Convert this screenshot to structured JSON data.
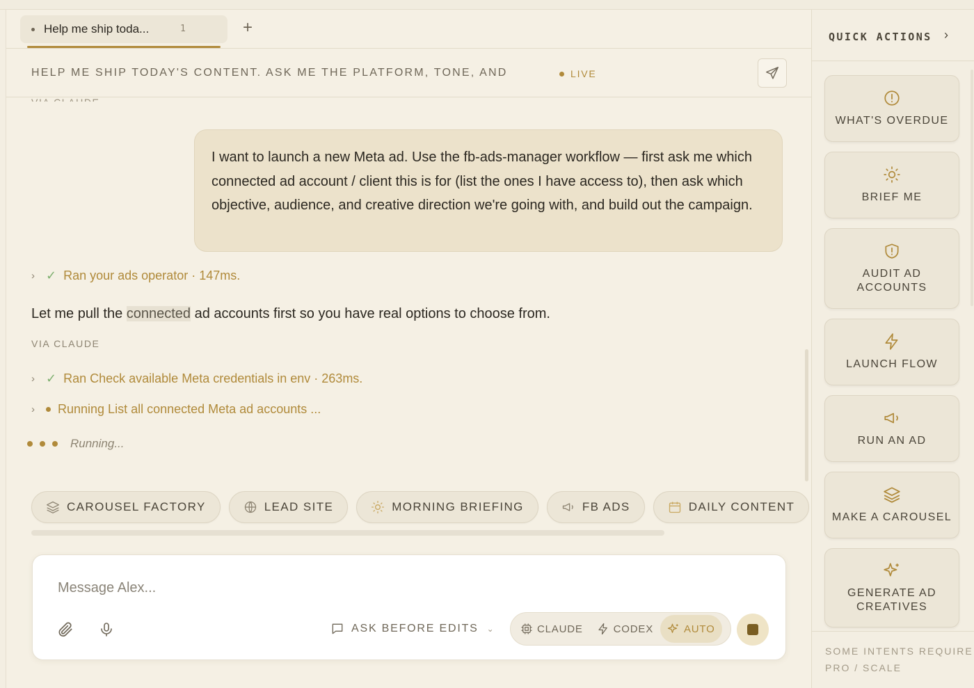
{
  "tabs": {
    "active_label": "Help me ship toda...",
    "active_count": "1",
    "new_tab": "+"
  },
  "banner": {
    "text": "HELP ME SHIP TODAY'S CONTENT. ASK ME THE PLATFORM, TONE, AND",
    "status": "LIVE"
  },
  "conversation": {
    "via_top": "VIA CLAUDE",
    "user_message": "I want to launch a new Meta ad. Use the fb-ads-manager workflow — first ask me which connected ad account / client this is for (list the ones I have access to), then ask which objective, audience, and creative direction we're going with, and build out the campaign.",
    "tool1": "Ran your ads operator · 147ms.",
    "assistant_pre": "Let me pull the ",
    "assistant_hl": "connected",
    "assistant_post": " ad accounts first so you have real options to choose from.",
    "via": "VIA CLAUDE",
    "tool2": "Ran Check available Meta credentials in env · 263ms.",
    "tool3": "Running List all connected Meta ad accounts ...",
    "running": "Running..."
  },
  "chips": [
    {
      "label": "CAROUSEL FACTORY",
      "icon": "layers-icon"
    },
    {
      "label": "LEAD SITE",
      "icon": "globe-icon"
    },
    {
      "label": "MORNING BRIEFING",
      "icon": "sun-icon"
    },
    {
      "label": "FB ADS",
      "icon": "megaphone-icon"
    },
    {
      "label": "DAILY CONTENT",
      "icon": "calendar-icon"
    }
  ],
  "composer": {
    "placeholder": "Message Alex...",
    "ask_mode": "ASK BEFORE EDITS",
    "models": [
      "CLAUDE",
      "CODEX",
      "AUTO"
    ],
    "active_model": "AUTO"
  },
  "sidebar": {
    "title": "QUICK ACTIONS",
    "actions": [
      {
        "label": "WHAT'S OVERDUE",
        "icon": "alert-circle-icon"
      },
      {
        "label": "BRIEF ME",
        "icon": "sun-icon"
      },
      {
        "label": "AUDIT AD ACCOUNTS",
        "icon": "shield-alert-icon"
      },
      {
        "label": "LAUNCH FLOW",
        "icon": "lightning-icon"
      },
      {
        "label": "RUN AN AD",
        "icon": "megaphone-icon"
      },
      {
        "label": "MAKE A CAROUSEL",
        "icon": "layers-icon"
      },
      {
        "label": "GENERATE AD CREATIVES",
        "icon": "sparkles-icon"
      }
    ],
    "footer": "SOME INTENTS REQUIRE PRO / SCALE"
  },
  "colors": {
    "accent": "#b08a3a",
    "background": "#f3eee2",
    "check": "#7fb070"
  }
}
